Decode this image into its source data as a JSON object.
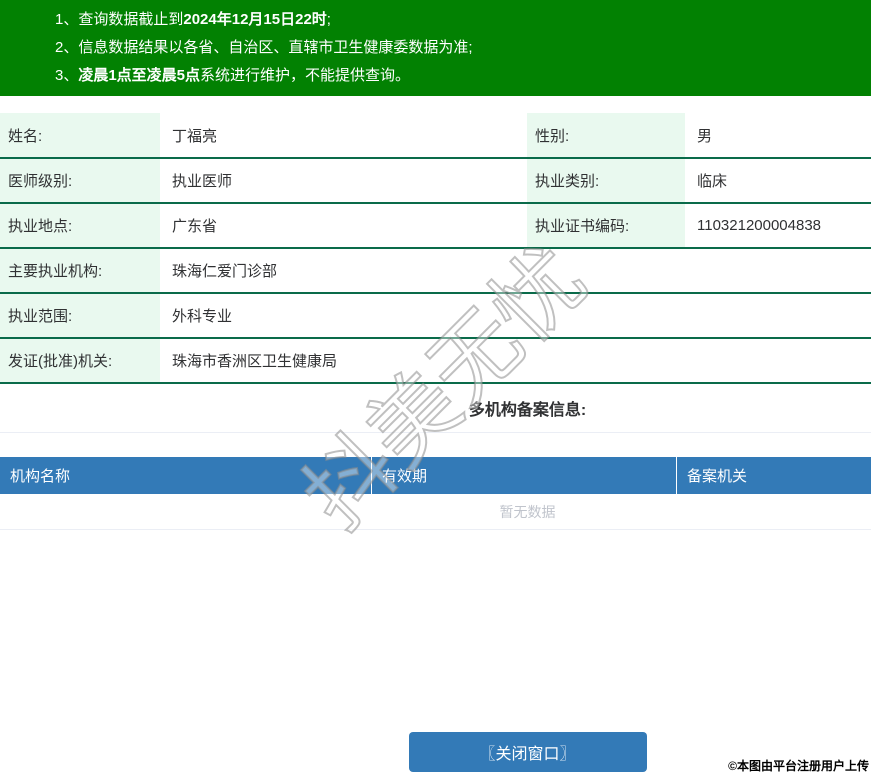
{
  "colors": {
    "green-bar": "#028102",
    "border-green": "#0a6b4a",
    "mint": "#e9f9ef",
    "blue": "#337ab7",
    "button-blue": "#337ab7",
    "empty-gray": "#c0c4cc",
    "light-border": "#ebeef5"
  },
  "notices": [
    {
      "num": "1、",
      "prefix": "查询数据截止到",
      "bold": "2024年12月15日22时",
      "suffix": ";"
    },
    {
      "num": "2、",
      "prefix": "信息数据结果以各省、自治区、直辖市卫生健康委数据为准;",
      "bold": "",
      "suffix": ""
    },
    {
      "num": "3、",
      "prefix": "",
      "bold": "凌晨1点至凌晨5点",
      "suffix": "系统进行维护，不能提供查询。"
    }
  ],
  "info": {
    "rows": [
      {
        "label1": "姓名:",
        "value1": "丁福亮",
        "label2": "性别:",
        "value2": "男"
      },
      {
        "label1": "医师级别:",
        "value1": "执业医师",
        "label2": "执业类别:",
        "value2": "临床"
      },
      {
        "label1": "执业地点:",
        "value1": "广东省",
        "label2": "执业证书编码:",
        "value2": "110321200004838"
      },
      {
        "label1": "主要执业机构:",
        "value1": "珠海仁爱门诊部"
      },
      {
        "label1": "执业范围:",
        "value1": "外科专业"
      },
      {
        "label1": "发证(批准)机关:",
        "value1": "珠海市香洲区卫生健康局"
      }
    ]
  },
  "section": {
    "title": "多机构备案信息:"
  },
  "filing_table": {
    "headers": {
      "institution": "机构名称",
      "validity": "有效期",
      "authority": "备案机关"
    },
    "empty_text": "暂无数据"
  },
  "footer": {
    "close_button": "〖关闭窗口〗"
  },
  "watermark": {
    "diagonal": "抖美无忧",
    "copyright": "©本图由平台注册用户上传"
  }
}
